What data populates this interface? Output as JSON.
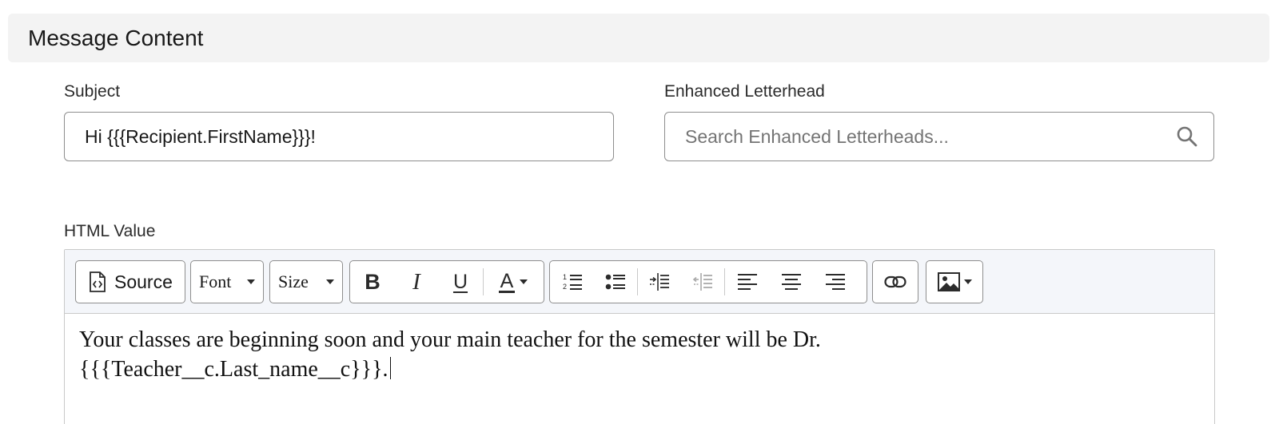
{
  "section": {
    "title": "Message Content"
  },
  "subject": {
    "label": "Subject",
    "value": "Hi {{{Recipient.FirstName}}}!"
  },
  "letterhead": {
    "label": "Enhanced Letterhead",
    "placeholder": "Search Enhanced Letterheads...",
    "icon": "search-icon"
  },
  "html_value": {
    "label": "HTML Value",
    "toolbar": {
      "source_label": "Source",
      "font_label": "Font",
      "size_label": "Size",
      "bold_label": "B",
      "italic_label": "I",
      "underline_label": "U",
      "text_color_label": "A"
    },
    "body": {
      "line1": "Your classes are beginning soon and your main teacher for the semester will be Dr.",
      "line2": "{{{Teacher__c.Last_name__c}}}."
    }
  }
}
